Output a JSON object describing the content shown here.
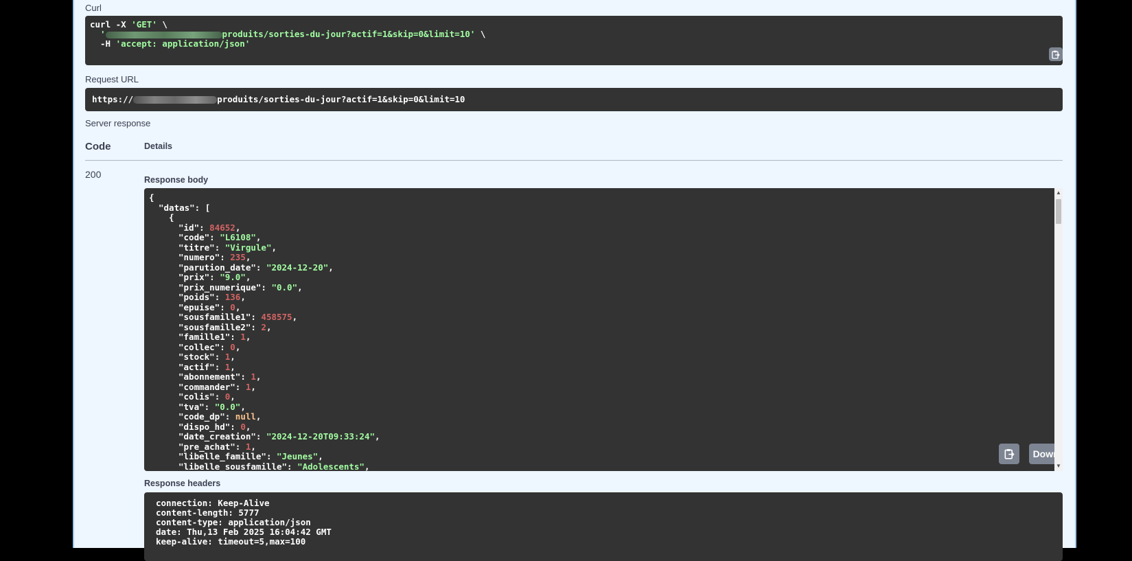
{
  "curl": {
    "label": "Curl",
    "line1_cmd": "curl -X ",
    "line1_method": "'GET'",
    "line1_tail": " \\",
    "line2_quote": "'",
    "line2_path": "produits/sorties-du-jour?actif=1&skip=0&limit=10'",
    "line2_tail": " \\",
    "line3_flag": "-H ",
    "line3_header": "'accept: application/json'"
  },
  "request_url": {
    "label": "Request URL",
    "prefix": "https://",
    "path": "produits/sorties-du-jour?actif=1&skip=0&limit=10"
  },
  "server_response": {
    "label": "Server response",
    "code_header": "Code",
    "details_header": "Details",
    "code": "200",
    "response_body_label": "Response body",
    "download_label": "Download",
    "response_headers_label": "Response headers"
  },
  "response_body": {
    "open_brace": "{",
    "datas_key": "\"datas\": [",
    "item_open": "{",
    "fields": [
      {
        "key": "\"id\"",
        "value": "84652",
        "type": "num"
      },
      {
        "key": "\"code\"",
        "value": "\"L6108\"",
        "type": "str"
      },
      {
        "key": "\"titre\"",
        "value": "\"Virgule\"",
        "type": "str"
      },
      {
        "key": "\"numero\"",
        "value": "235",
        "type": "num"
      },
      {
        "key": "\"parution_date\"",
        "value": "\"2024-12-20\"",
        "type": "str"
      },
      {
        "key": "\"prix\"",
        "value": "\"9.0\"",
        "type": "str"
      },
      {
        "key": "\"prix_numerique\"",
        "value": "\"0.0\"",
        "type": "str"
      },
      {
        "key": "\"poids\"",
        "value": "136",
        "type": "num"
      },
      {
        "key": "\"epuise\"",
        "value": "0",
        "type": "num"
      },
      {
        "key": "\"sousfamille1\"",
        "value": "458575",
        "type": "num"
      },
      {
        "key": "\"sousfamille2\"",
        "value": "2",
        "type": "num"
      },
      {
        "key": "\"famille1\"",
        "value": "1",
        "type": "num"
      },
      {
        "key": "\"collec\"",
        "value": "0",
        "type": "num"
      },
      {
        "key": "\"stock\"",
        "value": "1",
        "type": "num"
      },
      {
        "key": "\"actif\"",
        "value": "1",
        "type": "num"
      },
      {
        "key": "\"abonnement\"",
        "value": "1",
        "type": "num"
      },
      {
        "key": "\"commander\"",
        "value": "1",
        "type": "num"
      },
      {
        "key": "\"colis\"",
        "value": "0",
        "type": "num"
      },
      {
        "key": "\"tva\"",
        "value": "\"0.0\"",
        "type": "str"
      },
      {
        "key": "\"code_dp\"",
        "value": "null",
        "type": "nul"
      },
      {
        "key": "\"dispo_hd\"",
        "value": "0",
        "type": "num"
      },
      {
        "key": "\"date_creation\"",
        "value": "\"2024-12-20T09:33:24\"",
        "type": "str"
      },
      {
        "key": "\"pre_achat\"",
        "value": "1",
        "type": "num"
      },
      {
        "key": "\"libelle_famille\"",
        "value": "\"Jeunes\"",
        "type": "str"
      },
      {
        "key": "\"libelle_sousfamille\"",
        "value": "\"Adolescents\"",
        "type": "str"
      }
    ]
  },
  "response_headers": [
    "connection: Keep-Alive",
    "content-length: 5777",
    "content-type: application/json",
    "date: Thu,13 Feb 2025 16:04:42 GMT",
    "keep-alive: timeout=5,max=100"
  ],
  "icons": {
    "copy": "clipboard-icon",
    "scroll_up": "scroll-up-arrow-icon",
    "scroll_down": "scroll-down-arrow-icon"
  }
}
